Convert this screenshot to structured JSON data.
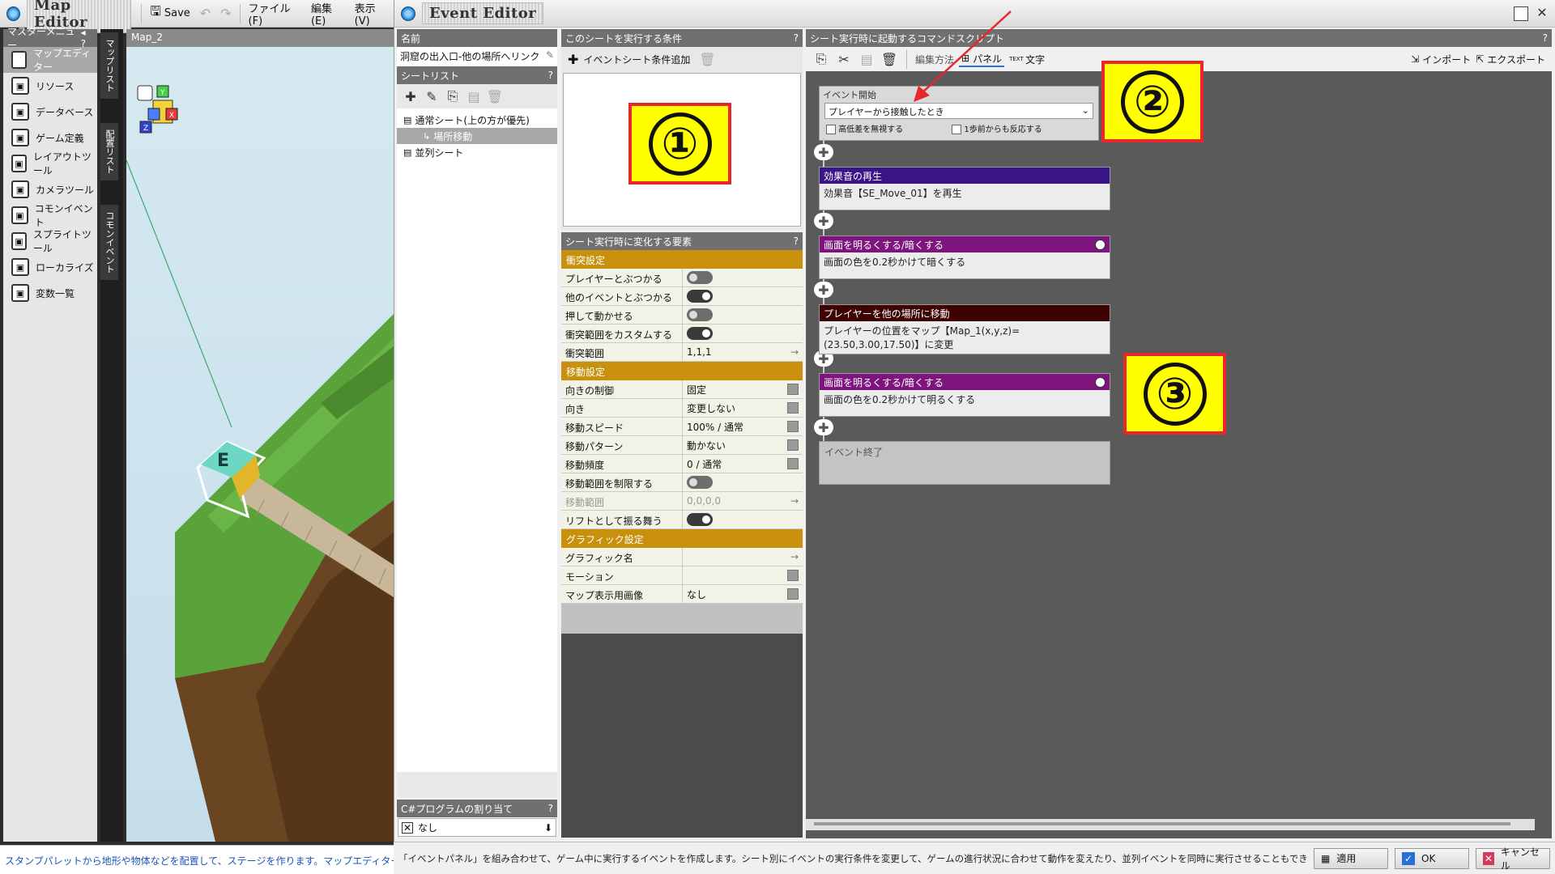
{
  "map_editor": {
    "title": "Map Editor",
    "save_label": "Save",
    "menus": [
      "ファイル(F)",
      "編集(E)",
      "表示(V)"
    ],
    "master_menu_title": "マスターメニュー",
    "master_menu_items": [
      {
        "label": "マップエディター",
        "icon": "map-icon"
      },
      {
        "label": "リソース",
        "icon": "resource-icon"
      },
      {
        "label": "データベース",
        "icon": "database-icon"
      },
      {
        "label": "ゲーム定義",
        "icon": "gamepad-icon"
      },
      {
        "label": "レイアウトツール",
        "icon": "layout-icon"
      },
      {
        "label": "カメラツール",
        "icon": "camera-icon"
      },
      {
        "label": "コモンイベント",
        "icon": "common-event-icon"
      },
      {
        "label": "スプライトツール",
        "icon": "sprite-icon"
      },
      {
        "label": "ローカライズ",
        "icon": "localize-icon"
      },
      {
        "label": "変数一覧",
        "icon": "variables-icon"
      }
    ],
    "vertical_tabs": [
      "マップリスト",
      "配置リスト",
      "コモンイベント"
    ],
    "viewport_tab": "Map_2",
    "axis_labels": [
      "Y",
      "X",
      "Z"
    ],
    "event_marker_letter": "E",
    "status_text": "スタンプパレットから地形や物体などを配置して、ステージを作ります。マップエディター内の各種"
  },
  "event_editor": {
    "title": "Event Editor",
    "name_header": "名前",
    "name_value": "洞窟の出入口-他の場所へリンク",
    "sheet_list_header": "シートリスト",
    "sheets": [
      {
        "label": "通常シート(上の方が優先)",
        "level": 0
      },
      {
        "label": "場所移動",
        "level": 1
      },
      {
        "label": "並列シート",
        "level": 0
      }
    ],
    "csharp_header": "C#プログラムの割り当て",
    "csharp_value": "なし",
    "condition_header": "このシートを実行する条件",
    "add_condition_label": "イベントシート条件追加",
    "properties_header": "シート実行時に変化する要素",
    "sections": [
      {
        "title": "衝突設定",
        "rows": [
          {
            "key": "プレイヤーとぶつかる",
            "type": "toggle",
            "on": false
          },
          {
            "key": "他のイベントとぶつかる",
            "type": "toggle",
            "on": true
          },
          {
            "key": "押して動かせる",
            "type": "toggle",
            "on": false
          },
          {
            "key": "衝突範囲をカスタムする",
            "type": "toggle",
            "on": true
          },
          {
            "key": "衝突範囲",
            "type": "arrow",
            "value": "1,1,1"
          }
        ]
      },
      {
        "title": "移動設定",
        "rows": [
          {
            "key": "向きの制御",
            "type": "dropdown",
            "value": "固定"
          },
          {
            "key": "向き",
            "type": "dropdown",
            "value": "変更しない"
          },
          {
            "key": "移動スピード",
            "type": "dropdown",
            "value": "100% / 通常"
          },
          {
            "key": "移動パターン",
            "type": "dropdown",
            "value": "動かない"
          },
          {
            "key": "移動頻度",
            "type": "dropdown",
            "value": "0 / 通常"
          },
          {
            "key": "移動範囲を制限する",
            "type": "toggle",
            "on": false
          },
          {
            "key": "移動範囲",
            "type": "arrow",
            "value": "0,0,0,0",
            "disabled": true
          },
          {
            "key": "リフトとして振る舞う",
            "type": "toggle",
            "on": true
          }
        ]
      },
      {
        "title": "グラフィック設定",
        "rows": [
          {
            "key": "グラフィック名",
            "type": "arrow",
            "value": ""
          },
          {
            "key": "モーション",
            "type": "dropdown",
            "value": ""
          },
          {
            "key": "マップ表示用画像",
            "type": "dropdown",
            "value": "なし"
          }
        ]
      }
    ],
    "script_header": "シート実行時に起動するコマンドスクリプト",
    "script_toolbar": {
      "edit_mode": "編集方法",
      "panel": "パネル",
      "text": "文字",
      "text_icon": "TEXT",
      "import": "インポート",
      "export": "エクスポート"
    },
    "event_start": {
      "label": "イベント開始",
      "trigger": "プレイヤーから接触したとき",
      "option1": "高低差を無視する",
      "option2": "1歩前からも反応する"
    },
    "commands": [
      {
        "title": "効果音の再生",
        "body": "効果音【SE_Move_01】を再生",
        "color": "#3a1587",
        "clock": false
      },
      {
        "title": "画面を明るくする/暗くする",
        "body": "画面の色を0.2秒かけて暗くする",
        "color": "#7e157f",
        "clock": true
      },
      {
        "title": "プレイヤーを他の場所に移動",
        "body": "プレイヤーの位置をマップ【Map_1(x,y,z)=(23.50,3.00,17.50)】に変更",
        "color": "#3d0303",
        "clock": false
      },
      {
        "title": "画面を明るくする/暗くする",
        "body": "画面の色を0.2秒かけて明るくする",
        "color": "#7e157f",
        "clock": true
      }
    ],
    "event_end": "イベント終了",
    "status_text": "「イベントパネル」を組み合わせて、ゲーム中に実行するイベントを作成します。シート別にイベントの実行条件を変更して、ゲームの進行状況に合わせて動作を変えたり、並列イベントを同時に実行させることもできます。",
    "buttons": {
      "apply": "適用",
      "ok": "OK",
      "cancel": "キャンセル"
    }
  },
  "callouts": [
    "①",
    "②",
    "③"
  ],
  "colors": {
    "section": "#c8900d",
    "callout_fill": "#ffff00",
    "callout_border": "#e8262b",
    "arrow": "#e8262b"
  }
}
